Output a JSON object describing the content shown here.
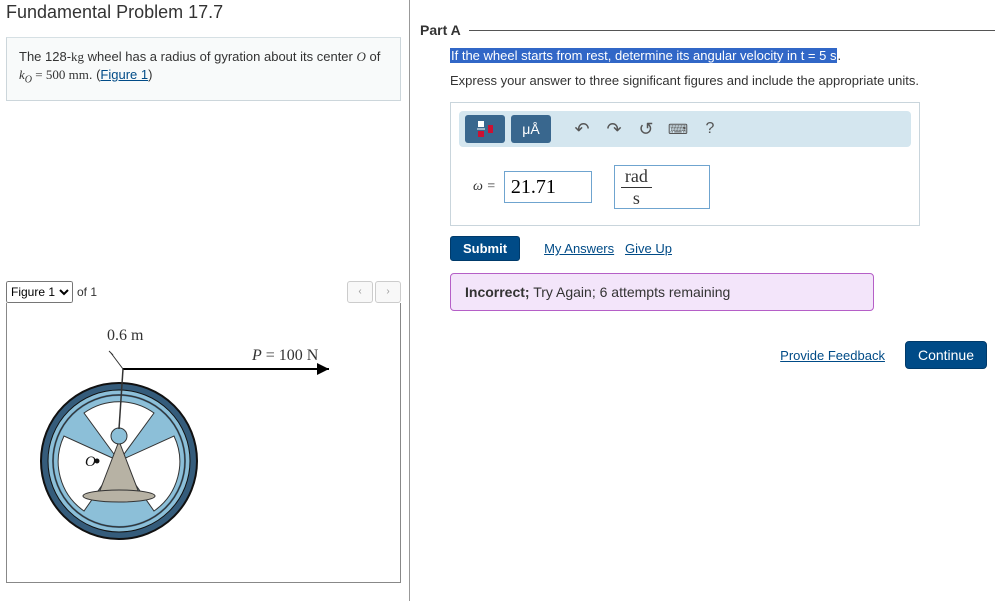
{
  "title": "Fundamental Problem 17.7",
  "problem": {
    "text_pre": "The 128-",
    "kg": "kg",
    "text_mid": " wheel has a radius of gyration about its center ",
    "O": "O",
    "text_k": " of ",
    "kO": "kO",
    "eq": " = 500 ",
    "mm": "mm",
    "text_end": ". (",
    "fig_link": "Figure 1",
    "close": ")"
  },
  "figure": {
    "selector": "Figure 1",
    "of": "of 1",
    "radius_label": "0.6 m",
    "force_label": "P = 100 N",
    "center_label": "O"
  },
  "part": {
    "label": "Part A",
    "prompt_hl": "If the wheel starts from rest, determine its angular velocity in t = 5 s",
    "period": ".",
    "hint": "Express your answer to three significant figures and include the appropriate units."
  },
  "toolbar": {
    "fraction": "□/□",
    "units": "μÅ",
    "undo": "↶",
    "redo": "↷",
    "reset": "↺",
    "keyboard": "⌨",
    "help": "?"
  },
  "answer": {
    "symbol": "ω =",
    "value": "21.71",
    "unit_top": "rad",
    "unit_bot": "s"
  },
  "actions": {
    "submit": "Submit",
    "my_answers": "My Answers",
    "give_up": "Give Up"
  },
  "feedback": {
    "bold": "Incorrect;",
    "rest": " Try Again; 6 attempts remaining"
  },
  "footer": {
    "provide": "Provide Feedback",
    "continue": "Continue"
  }
}
